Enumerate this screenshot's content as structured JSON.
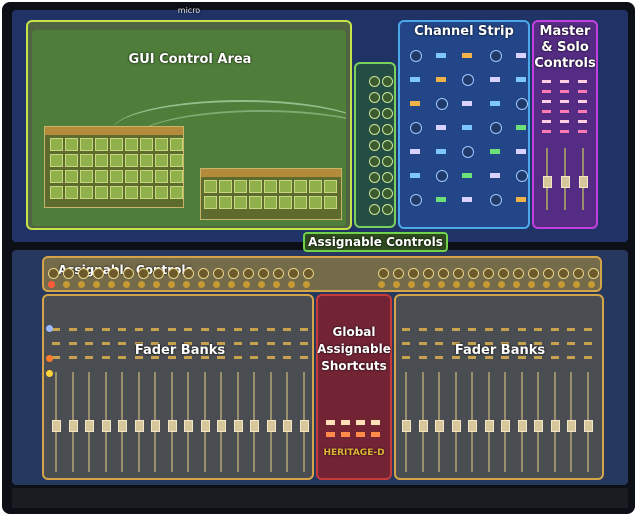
{
  "labels": {
    "gui_control_area": "GUI Control Area",
    "channel_strip": "Channel Strip",
    "master_solo_line1": "Master",
    "master_solo_line2": "& Solo",
    "master_solo_line3": "Controls",
    "assignable_controls_top": "Assignable Controls",
    "assignable_controls_strip": "Assignable Controls",
    "fader_banks_left": "Fader Banks",
    "fader_banks_right": "Fader Banks",
    "global_line1": "Global",
    "global_line2": "Assignable",
    "global_line3": "Shortcuts"
  },
  "console": {
    "brand_small": "micro",
    "model": "HERITAGE-D"
  },
  "colors": {
    "gui_outline": "#c8e34a",
    "assign_column_outline": "#79d05a",
    "channel_outline": "#4aa8e8",
    "master_outline": "#c43fe0",
    "fader_outline": "#d4a449",
    "global_outline": "#c63a3a"
  }
}
